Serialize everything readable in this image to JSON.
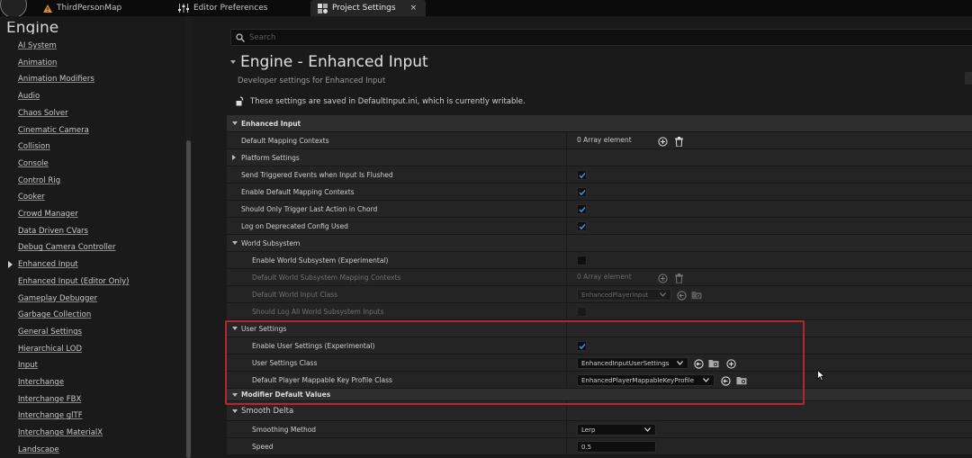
{
  "tabs": [
    {
      "label": "ThirdPersonMap",
      "icon": "level-warning-icon"
    },
    {
      "label": "Editor Preferences",
      "icon": "sliders-icon"
    },
    {
      "label": "Project Settings",
      "icon": "project-settings-icon",
      "active": true,
      "close": "×"
    }
  ],
  "sidebar": {
    "title": "Engine",
    "items": [
      "AI System",
      "Animation",
      "Animation Modifiers",
      "Audio",
      "Chaos Solver",
      "Cinematic Camera",
      "Collision",
      "Console",
      "Control Rig",
      "Cooker",
      "Crowd Manager",
      "Data Driven CVars",
      "Debug Camera Controller",
      "Enhanced Input",
      "Enhanced Input (Editor Only)",
      "Gameplay Debugger",
      "Garbage Collection",
      "General Settings",
      "Hierarchical LOD",
      "Input",
      "Interchange",
      "Interchange FBX",
      "Interchange glTF",
      "Interchange MaterialX",
      "Landscape"
    ],
    "selected_index": 13
  },
  "search": {
    "placeholder": "Search"
  },
  "header": {
    "title": "Engine - Enhanced Input",
    "subtitle": "Developer settings for Enhanced Input",
    "saved_note": "These settings are saved in DefaultInput.ini, which is currently writable."
  },
  "grid": {
    "enhanced_input": {
      "label": "Enhanced Input",
      "default_mapping_contexts": {
        "label": "Default Mapping Contexts",
        "value": "0 Array element"
      },
      "platform_settings": "Platform Settings",
      "send_triggered_events": {
        "label": "Send Triggered Events when Input Is Flushed",
        "checked": true
      },
      "enable_default_mapping_contexts": {
        "label": "Enable Default Mapping Contexts",
        "checked": true
      },
      "only_trigger_last_action": {
        "label": "Should Only Trigger Last Action in Chord",
        "checked": true
      },
      "log_deprecated": {
        "label": "Log on Deprecated Config Used",
        "checked": true
      }
    },
    "world_subsystem": {
      "label": "World Subsystem",
      "enable_world_subsystem": {
        "label": "Enable World Subsystem (Experimental)",
        "checked": false
      },
      "default_world_mapping_contexts": {
        "label": "Default World Subsystem Mapping Contexts",
        "value": "0 Array element"
      },
      "default_world_input_class": {
        "label": "Default World Input Class",
        "value": "EnhancedPlayerInput"
      },
      "should_log_all": {
        "label": "Should Log All World Subsystem Inputs",
        "checked": false
      }
    },
    "user_settings": {
      "label": "User Settings",
      "enable_user_settings": {
        "label": "Enable User Settings (Experimental)",
        "checked": true
      },
      "user_settings_class": {
        "label": "User Settings Class",
        "value": "EnhancedInputUserSettings"
      },
      "default_key_profile_class": {
        "label": "Default Player Mappable Key Profile Class",
        "value": "EnhancedPlayerMappableKeyProfile"
      }
    },
    "modifier_default_values": {
      "label": "Modifier Default Values"
    },
    "smooth_delta": {
      "label": "Smooth Delta",
      "smoothing_method": {
        "label": "Smoothing Method",
        "value": "Lerp"
      },
      "speed": {
        "label": "Speed",
        "value": "0.5"
      }
    }
  },
  "colors": {
    "highlight": "#b4282c",
    "checkbox_check": "#3d8be0",
    "background": "#1a1a1a"
  }
}
